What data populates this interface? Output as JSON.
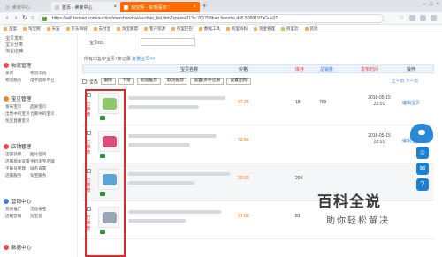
{
  "browser": {
    "tabs": [
      {
        "label": "卖家中心"
      },
      {
        "label": "首页 - 卖家中心"
      },
      {
        "label": "淘宝网 - 淘!我喜欢 !"
      }
    ],
    "url": "https://sell.taobao.com/auction/merchandise/auction_list.htm?spm=a313o.201708ban.favorite.d45.5958197aGua22",
    "bookmarks": [
      "百度",
      "淘宝网",
      "天猫",
      "京东商城",
      "支付宝",
      "淘宝联盟",
      "客户资源",
      "阿里巴巴",
      "数据工具",
      "阿里妈妈",
      "资金管理",
      "阿里云",
      "其他"
    ]
  },
  "sidebar": {
    "top": [
      "宝贝发布",
      "宝贝分类",
      "淘宝店铺"
    ],
    "groups": [
      {
        "title": "物流管理",
        "icon_color": "#e94f4f",
        "items": [
          "发货",
          "物流工具",
          "物流服务",
          "电子面单平台"
        ]
      },
      {
        "title": "宝贝管理",
        "icon_color": "#f08a24",
        "items": [
          "发布宝贝",
          "品质宝贝",
          "出售中的宝贝",
          "仓库中的宝贝",
          "淘宝直播宝贝"
        ]
      },
      {
        "title": "店铺管理",
        "icon_color": "#e94f4f",
        "items": [
          "店铺装修",
          "图片空间",
          "店铺基本设置",
          "手机淘宝店铺",
          "子账号管理",
          "域名设置",
          "店铺服务",
          "淘宝服务"
        ]
      },
      {
        "title": "营销中心",
        "icon_color": "#3b7dd8",
        "items": [
          "我要推广",
          "活动报名",
          "店铺营销",
          "淘宝客"
        ]
      },
      {
        "title": "数据中心",
        "icon_color": "#e94f4f",
        "items": []
      }
    ]
  },
  "main": {
    "filter_label": "宝贝ID :",
    "notice": "所有出售中宝贝7条记录",
    "notice_link": "批量宝贝>>",
    "columns": {
      "name": "宝贝名称",
      "price": "价格",
      "stock": "库存",
      "sales": "总销量",
      "time": "发布时间",
      "ops": "操作"
    },
    "toolbar": {
      "select_all": "全选",
      "delete": "删除",
      "offline": "下架",
      "recommend": "橱窗推荐",
      "cancel_recommend": "取消推荐",
      "set_discount": "设置/多件优惠",
      "set_group": "设置团购",
      "pager": "上一页  下一页"
    },
    "rows": [
      {
        "badge": "已推荐",
        "price": "97.26",
        "stock": "18",
        "sales": "769",
        "date": "2018-05-15",
        "time": "22:01",
        "op": "编辑宝贝",
        "color": "#8bc96a"
      },
      {
        "badge": "已推荐",
        "price": "72.00",
        "stock": "",
        "sales": "",
        "date": "2018-05-15",
        "time": "22:01",
        "op": "编辑宝贝",
        "color": "#d94d7a"
      },
      {
        "badge": "已推荐",
        "price": "39.60",
        "stock": "294",
        "sales": "",
        "date": "",
        "time": "",
        "op": "",
        "color": "#5aa4d6"
      },
      {
        "badge": "已推荐",
        "price": "97.00",
        "stock": "81",
        "sales": "",
        "date": "",
        "time": "",
        "op": "",
        "color": "#9aa6b6"
      }
    ]
  },
  "watermark": {
    "title": "百科全说",
    "subtitle": "助你轻松解决"
  }
}
